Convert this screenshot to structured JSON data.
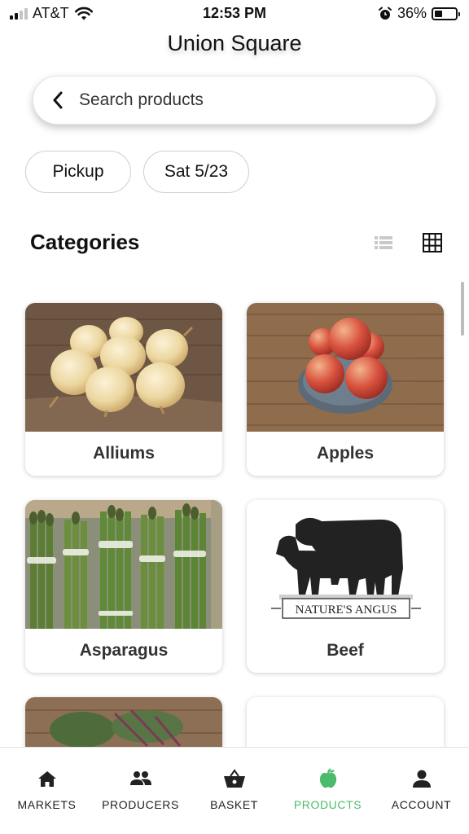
{
  "status_bar": {
    "carrier": "AT&T",
    "time": "12:53 PM",
    "battery_percent": "36%",
    "battery_level": 0.36
  },
  "header": {
    "market_name": "Union Square"
  },
  "search": {
    "placeholder": "Search products"
  },
  "filters": {
    "fulfillment": "Pickup",
    "date": "Sat 5/23"
  },
  "categories": {
    "title": "Categories",
    "view_modes": [
      "list-icon",
      "grid-icon"
    ],
    "active_view": "grid",
    "items": [
      {
        "name": "Alliums",
        "image": "onions-photo"
      },
      {
        "name": "Apples",
        "image": "apples-photo"
      },
      {
        "name": "Asparagus",
        "image": "asparagus-photo"
      },
      {
        "name": "Beef",
        "image": "natures-angus-logo",
        "logo_text": "NATURE'S ANGUS"
      },
      {
        "name": "",
        "image": "beets-photo"
      },
      {
        "name": "",
        "image": ""
      }
    ]
  },
  "nav": {
    "items": [
      {
        "label": "MARKETS",
        "icon": "home-icon"
      },
      {
        "label": "PRODUCERS",
        "icon": "people-icon"
      },
      {
        "label": "BASKET",
        "icon": "basket-icon"
      },
      {
        "label": "PRODUCTS",
        "icon": "apple-icon"
      },
      {
        "label": "ACCOUNT",
        "icon": "person-icon"
      }
    ],
    "active": "PRODUCTS"
  },
  "colors": {
    "accent": "#4cbb6c",
    "text": "#111111",
    "nav_text": "#222222"
  }
}
